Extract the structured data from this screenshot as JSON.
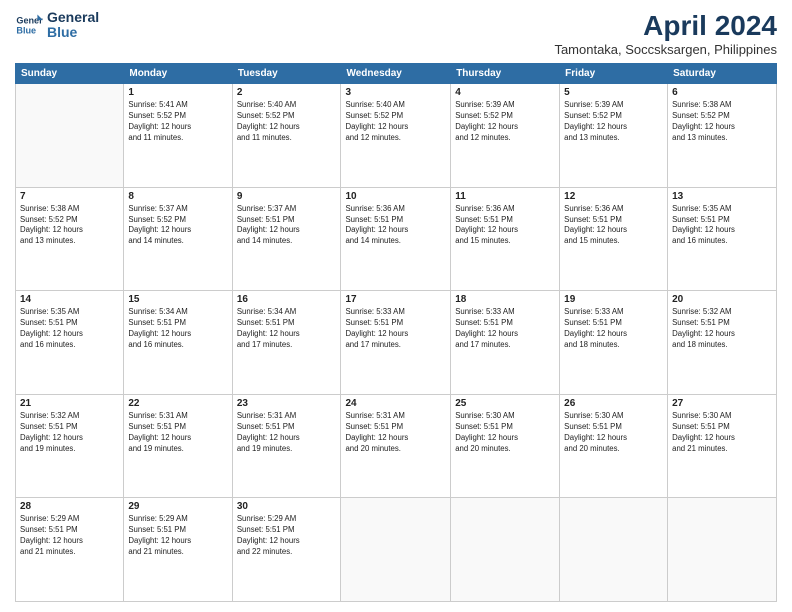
{
  "header": {
    "logo_line1": "General",
    "logo_line2": "Blue",
    "month": "April 2024",
    "location": "Tamontaka, Soccsksargen, Philippines"
  },
  "weekdays": [
    "Sunday",
    "Monday",
    "Tuesday",
    "Wednesday",
    "Thursday",
    "Friday",
    "Saturday"
  ],
  "weeks": [
    [
      {
        "day": "",
        "info": ""
      },
      {
        "day": "1",
        "info": "Sunrise: 5:41 AM\nSunset: 5:52 PM\nDaylight: 12 hours\nand 11 minutes."
      },
      {
        "day": "2",
        "info": "Sunrise: 5:40 AM\nSunset: 5:52 PM\nDaylight: 12 hours\nand 11 minutes."
      },
      {
        "day": "3",
        "info": "Sunrise: 5:40 AM\nSunset: 5:52 PM\nDaylight: 12 hours\nand 12 minutes."
      },
      {
        "day": "4",
        "info": "Sunrise: 5:39 AM\nSunset: 5:52 PM\nDaylight: 12 hours\nand 12 minutes."
      },
      {
        "day": "5",
        "info": "Sunrise: 5:39 AM\nSunset: 5:52 PM\nDaylight: 12 hours\nand 13 minutes."
      },
      {
        "day": "6",
        "info": "Sunrise: 5:38 AM\nSunset: 5:52 PM\nDaylight: 12 hours\nand 13 minutes."
      }
    ],
    [
      {
        "day": "7",
        "info": "Sunrise: 5:38 AM\nSunset: 5:52 PM\nDaylight: 12 hours\nand 13 minutes."
      },
      {
        "day": "8",
        "info": "Sunrise: 5:37 AM\nSunset: 5:52 PM\nDaylight: 12 hours\nand 14 minutes."
      },
      {
        "day": "9",
        "info": "Sunrise: 5:37 AM\nSunset: 5:51 PM\nDaylight: 12 hours\nand 14 minutes."
      },
      {
        "day": "10",
        "info": "Sunrise: 5:36 AM\nSunset: 5:51 PM\nDaylight: 12 hours\nand 14 minutes."
      },
      {
        "day": "11",
        "info": "Sunrise: 5:36 AM\nSunset: 5:51 PM\nDaylight: 12 hours\nand 15 minutes."
      },
      {
        "day": "12",
        "info": "Sunrise: 5:36 AM\nSunset: 5:51 PM\nDaylight: 12 hours\nand 15 minutes."
      },
      {
        "day": "13",
        "info": "Sunrise: 5:35 AM\nSunset: 5:51 PM\nDaylight: 12 hours\nand 16 minutes."
      }
    ],
    [
      {
        "day": "14",
        "info": "Sunrise: 5:35 AM\nSunset: 5:51 PM\nDaylight: 12 hours\nand 16 minutes."
      },
      {
        "day": "15",
        "info": "Sunrise: 5:34 AM\nSunset: 5:51 PM\nDaylight: 12 hours\nand 16 minutes."
      },
      {
        "day": "16",
        "info": "Sunrise: 5:34 AM\nSunset: 5:51 PM\nDaylight: 12 hours\nand 17 minutes."
      },
      {
        "day": "17",
        "info": "Sunrise: 5:33 AM\nSunset: 5:51 PM\nDaylight: 12 hours\nand 17 minutes."
      },
      {
        "day": "18",
        "info": "Sunrise: 5:33 AM\nSunset: 5:51 PM\nDaylight: 12 hours\nand 17 minutes."
      },
      {
        "day": "19",
        "info": "Sunrise: 5:33 AM\nSunset: 5:51 PM\nDaylight: 12 hours\nand 18 minutes."
      },
      {
        "day": "20",
        "info": "Sunrise: 5:32 AM\nSunset: 5:51 PM\nDaylight: 12 hours\nand 18 minutes."
      }
    ],
    [
      {
        "day": "21",
        "info": "Sunrise: 5:32 AM\nSunset: 5:51 PM\nDaylight: 12 hours\nand 19 minutes."
      },
      {
        "day": "22",
        "info": "Sunrise: 5:31 AM\nSunset: 5:51 PM\nDaylight: 12 hours\nand 19 minutes."
      },
      {
        "day": "23",
        "info": "Sunrise: 5:31 AM\nSunset: 5:51 PM\nDaylight: 12 hours\nand 19 minutes."
      },
      {
        "day": "24",
        "info": "Sunrise: 5:31 AM\nSunset: 5:51 PM\nDaylight: 12 hours\nand 20 minutes."
      },
      {
        "day": "25",
        "info": "Sunrise: 5:30 AM\nSunset: 5:51 PM\nDaylight: 12 hours\nand 20 minutes."
      },
      {
        "day": "26",
        "info": "Sunrise: 5:30 AM\nSunset: 5:51 PM\nDaylight: 12 hours\nand 20 minutes."
      },
      {
        "day": "27",
        "info": "Sunrise: 5:30 AM\nSunset: 5:51 PM\nDaylight: 12 hours\nand 21 minutes."
      }
    ],
    [
      {
        "day": "28",
        "info": "Sunrise: 5:29 AM\nSunset: 5:51 PM\nDaylight: 12 hours\nand 21 minutes."
      },
      {
        "day": "29",
        "info": "Sunrise: 5:29 AM\nSunset: 5:51 PM\nDaylight: 12 hours\nand 21 minutes."
      },
      {
        "day": "30",
        "info": "Sunrise: 5:29 AM\nSunset: 5:51 PM\nDaylight: 12 hours\nand 22 minutes."
      },
      {
        "day": "",
        "info": ""
      },
      {
        "day": "",
        "info": ""
      },
      {
        "day": "",
        "info": ""
      },
      {
        "day": "",
        "info": ""
      }
    ]
  ]
}
